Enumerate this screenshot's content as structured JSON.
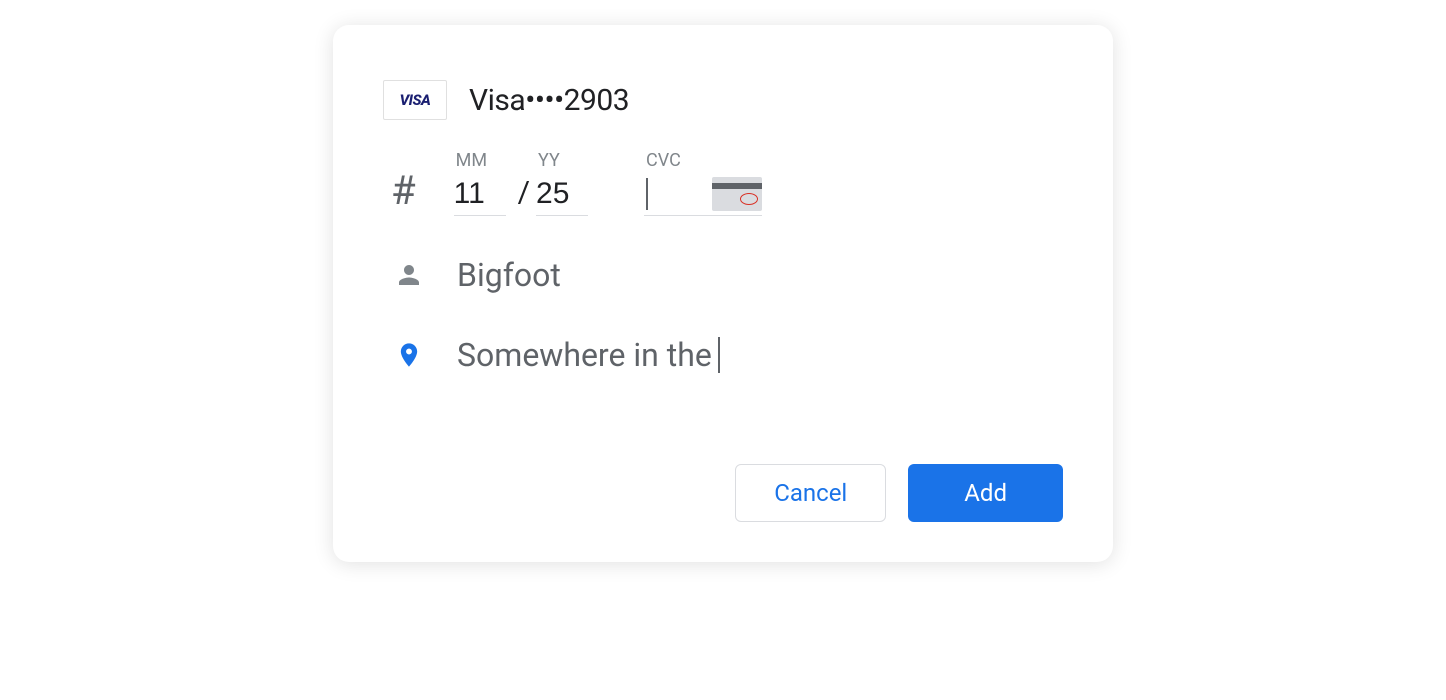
{
  "card": {
    "brand_label": "VISA",
    "title": "Visa••••2903"
  },
  "expiry": {
    "mm_label": "MM",
    "yy_label": "YY",
    "mm_value": "11",
    "yy_value": "25",
    "separator": "/",
    "hash": "#"
  },
  "cvc": {
    "label": "CVC",
    "value": ""
  },
  "name": {
    "value": "Bigfoot"
  },
  "address": {
    "value": "Somewhere in the "
  },
  "buttons": {
    "cancel": "Cancel",
    "add": "Add"
  }
}
